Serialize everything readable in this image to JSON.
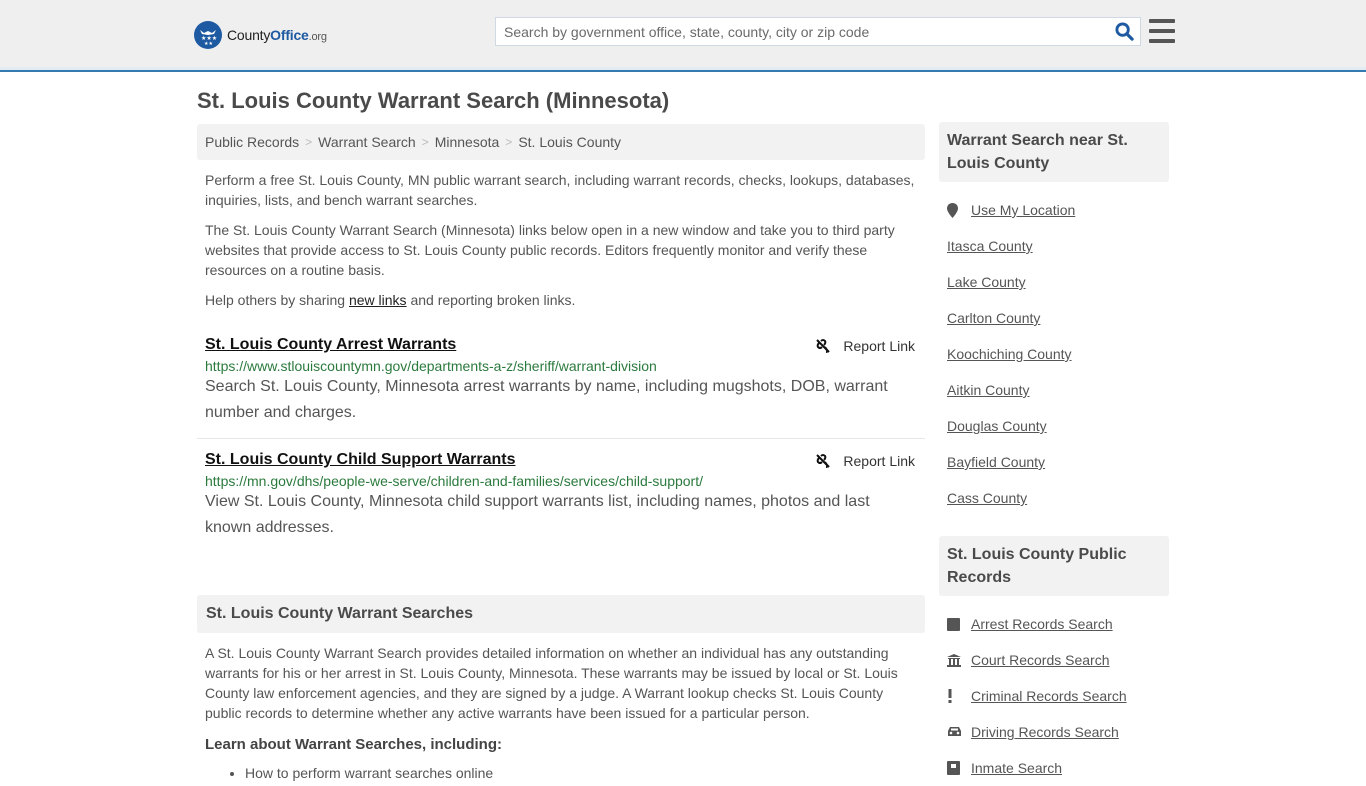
{
  "header": {
    "logo": {
      "name_part1": "County",
      "name_part2": "Office",
      "tld": ".org"
    },
    "search": {
      "placeholder": "Search by government office, state, county, city or zip code",
      "value": ""
    },
    "colors": {
      "brand": "#1d5aa1",
      "header_border": "#3579b3"
    }
  },
  "page": {
    "title": "St. Louis County Warrant Search (Minnesota)",
    "breadcrumb": [
      {
        "label": "Public Records"
      },
      {
        "label": "Warrant Search"
      },
      {
        "label": "Minnesota"
      },
      {
        "label": "St. Louis County"
      }
    ],
    "intro": {
      "p1": "Perform a free St. Louis County, MN public warrant search, including warrant records, checks, lookups, databases, inquiries, lists, and bench warrant searches.",
      "p2": "The St. Louis County Warrant Search (Minnesota) links below open in a new window and take you to third party websites that provide access to St. Louis County public records. Editors frequently monitor and verify these resources on a routine basis.",
      "p3_before": "Help others by sharing ",
      "p3_link": "new links",
      "p3_after": " and reporting broken links."
    },
    "listings": [
      {
        "title": "St. Louis County Arrest Warrants",
        "report_label": "Report Link",
        "url": "https://www.stlouiscountymn.gov/departments-a-z/sheriff/warrant-division",
        "description": "Search St. Louis County, Minnesota arrest warrants by name, including mugshots, DOB, warrant number and charges."
      },
      {
        "title": "St. Louis County Child Support Warrants",
        "report_label": "Report Link",
        "url": "https://mn.gov/dhs/people-we-serve/children-and-families/services/child-support/",
        "description": "View St. Louis County, Minnesota child support warrants list, including names, photos and last known addresses."
      }
    ],
    "section": {
      "heading": "St. Louis County Warrant Searches",
      "body": "A St. Louis County Warrant Search provides detailed information on whether an individual has any outstanding warrants for his or her arrest in St. Louis County, Minnesota. These warrants may be issued by local or St. Louis County law enforcement agencies, and they are signed by a judge. A Warrant lookup checks St. Louis County public records to determine whether any active warrants have been issued for a particular person.",
      "learn_heading": "Learn about Warrant Searches, including:",
      "learn_items": [
        "How to perform warrant searches online"
      ]
    }
  },
  "sidebar": {
    "nearby": {
      "heading": "Warrant Search near St. Louis County",
      "use_location": "Use My Location",
      "counties": [
        "Itasca County",
        "Lake County",
        "Carlton County",
        "Koochiching County",
        "Aitkin County",
        "Douglas County",
        "Bayfield County",
        "Cass County"
      ]
    },
    "public_records": {
      "heading": "St. Louis County Public Records",
      "items": [
        {
          "label": "Arrest Records Search",
          "icon": "book-icon"
        },
        {
          "label": "Court Records Search",
          "icon": "courthouse-icon"
        },
        {
          "label": "Criminal Records Search",
          "icon": "exclamation-icon"
        },
        {
          "label": "Driving Records Search",
          "icon": "car-icon"
        },
        {
          "label": "Inmate Search",
          "icon": "inmate-icon"
        }
      ]
    }
  }
}
